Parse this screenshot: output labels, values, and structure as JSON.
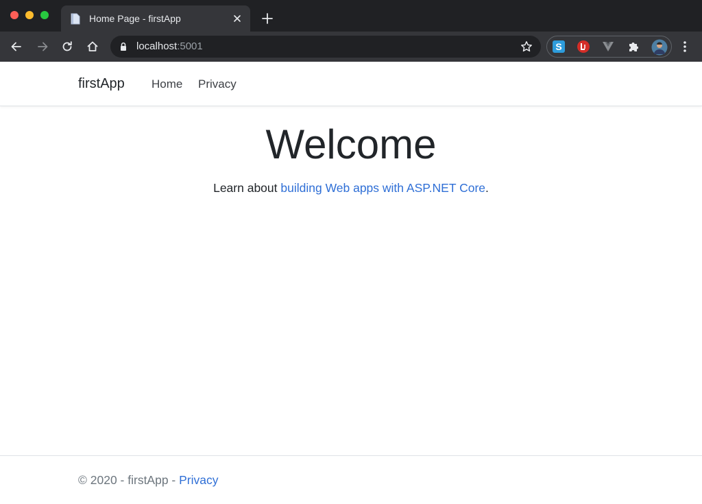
{
  "browser": {
    "tab_title": "Home Page - firstApp",
    "url_host": "localhost",
    "url_port": ":5001",
    "controls": {
      "back": "back-icon",
      "forward": "forward-icon",
      "reload": "reload-icon",
      "home": "home-icon",
      "bookmark": "star-icon",
      "new_tab": "plus-icon",
      "menu": "more-vert-icon"
    },
    "extensions": [
      "s-extension-icon",
      "lastpass-extension-icon",
      "vue-devtools-icon",
      "puzzle-extensions-icon",
      "profile-avatar"
    ],
    "colors": {
      "tabstrip": "#202124",
      "toolbar": "#35363a",
      "omnibox": "#202124"
    }
  },
  "site": {
    "brand": "firstApp",
    "nav": [
      "Home",
      "Privacy"
    ]
  },
  "main": {
    "title": "Welcome",
    "text_prefix": "Learn about ",
    "link_text": "building Web apps with ASP.NET Core",
    "text_suffix": "."
  },
  "footer": {
    "text": "© 2020 - firstApp - ",
    "link_text": "Privacy"
  },
  "colors": {
    "link": "#2f6fd6",
    "text": "#212529",
    "muted": "#6c757d",
    "border": "#dee2e6"
  }
}
